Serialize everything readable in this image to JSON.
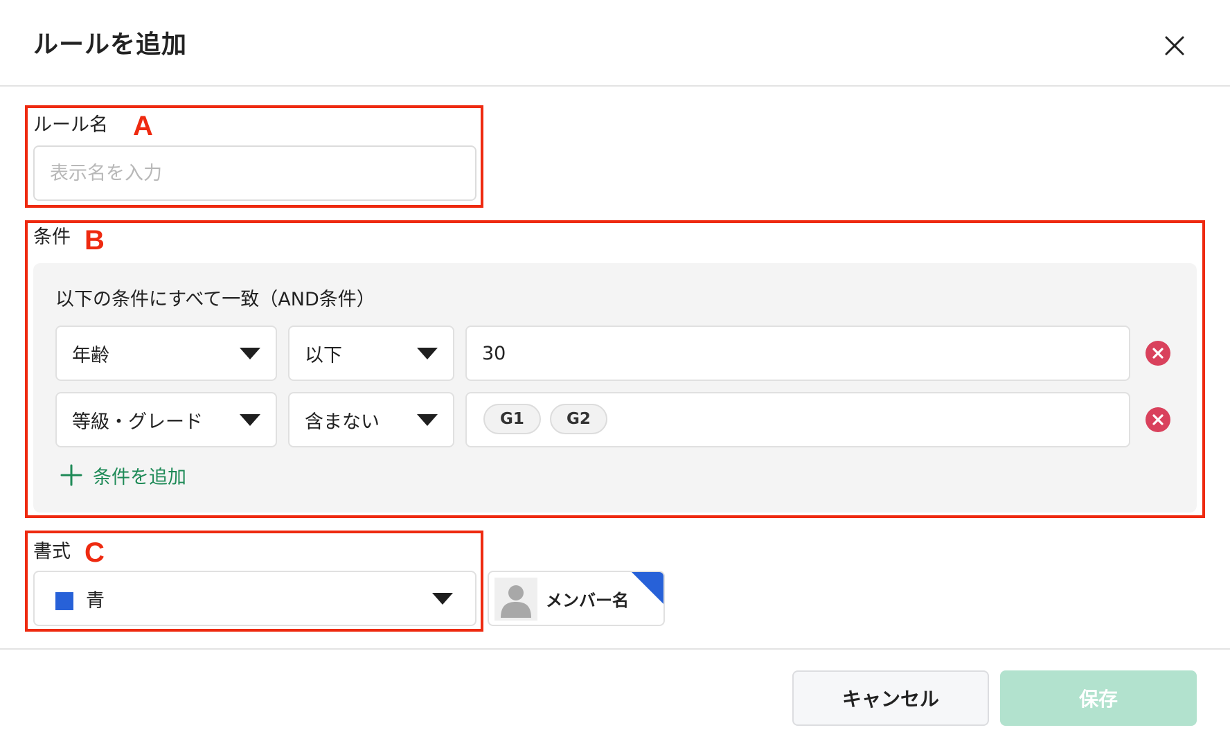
{
  "dialog": {
    "title": "ルールを追加",
    "close_icon": "close-icon"
  },
  "annotations": {
    "a": "A",
    "b": "B",
    "c": "C",
    "color": "#ee2a10"
  },
  "rule_name": {
    "label": "ルール名",
    "placeholder": "表示名を入力",
    "value": ""
  },
  "conditions": {
    "label": "条件",
    "description": "以下の条件にすべて一致（AND条件）",
    "rows": [
      {
        "field": "年齢",
        "operator": "以下",
        "value": "30",
        "chips": []
      },
      {
        "field": "等級・グレード",
        "operator": "含まない",
        "value": "",
        "chips": [
          "G1",
          "G2"
        ]
      }
    ],
    "add_label": "条件を追加",
    "accent_color": "#1e8a57",
    "remove_color": "#d9415c"
  },
  "format": {
    "label": "書式",
    "selected": "青",
    "swatch_color": "#2761d8",
    "preview_name": "メンバー名",
    "preview_icon": "avatar-icon"
  },
  "footer": {
    "cancel_label": "キャンセル",
    "save_label": "保存",
    "save_color": "#b2e2ce"
  }
}
